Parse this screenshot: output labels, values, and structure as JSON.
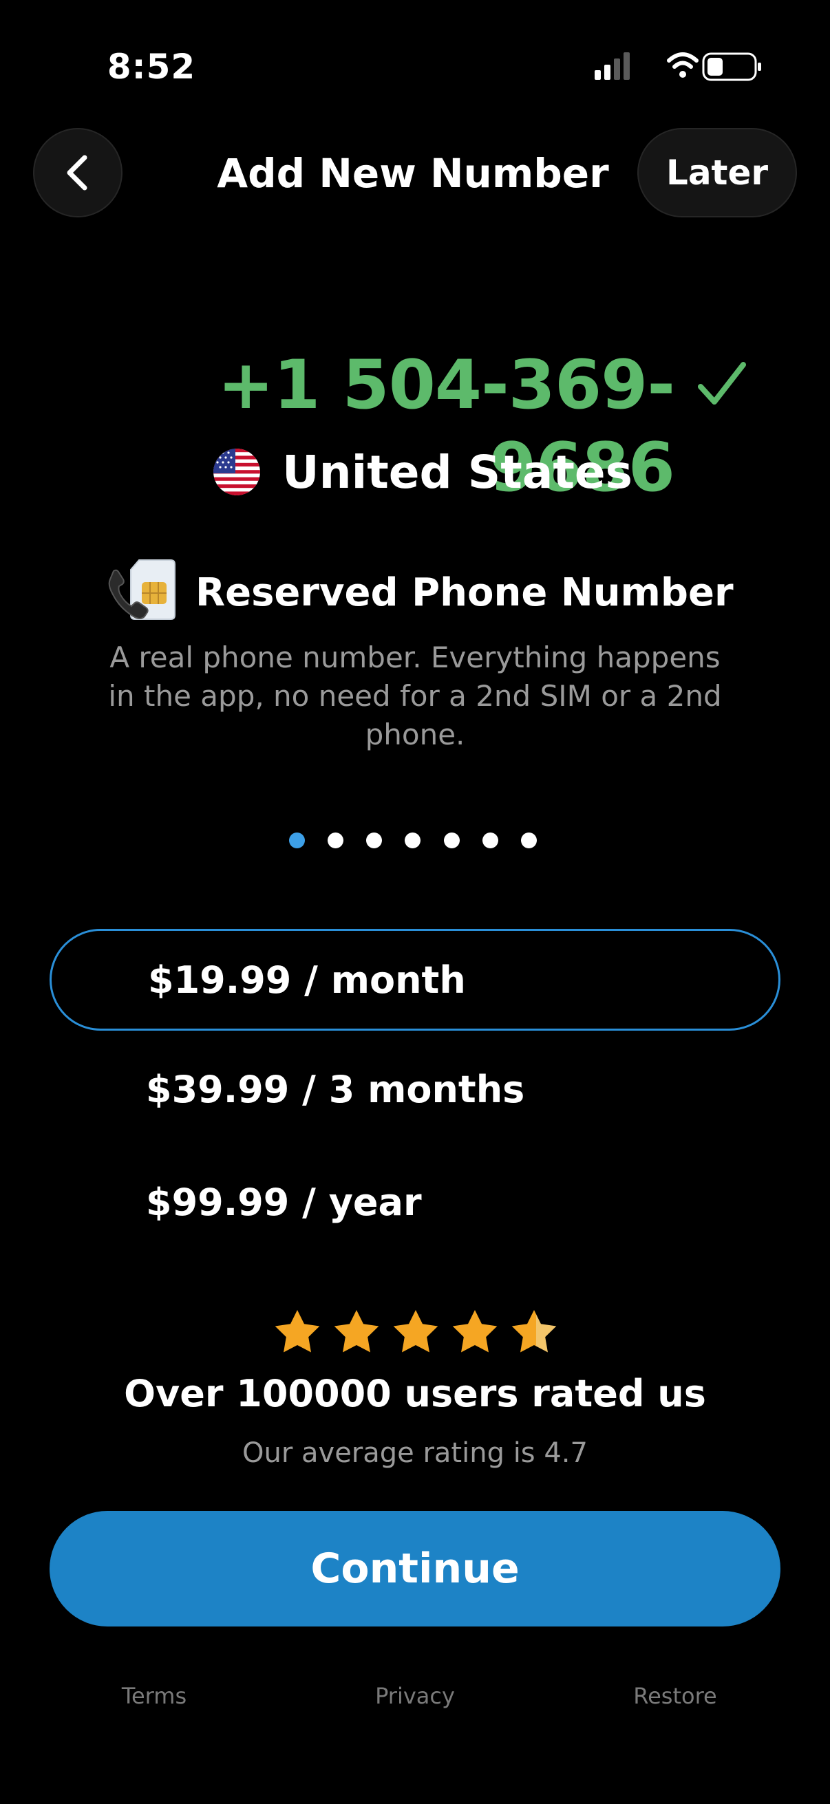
{
  "status_bar": {
    "time": "8:52",
    "icons": [
      "cellular-signal-icon",
      "wifi-icon",
      "battery-icon"
    ]
  },
  "header": {
    "back_icon": "chevron-left-icon",
    "title": "Add New Number",
    "later_label": "Later"
  },
  "number": {
    "phone": "+1 504-369-9686",
    "verified_icon": "check-icon",
    "accent_color": "#5dba6b",
    "country_flag_icon": "us-flag-icon",
    "country": "United States"
  },
  "feature": {
    "icon": "phone-sim-icon",
    "title": "Reserved Phone Number",
    "description": "A real phone number. Everything happens in the app, no need for a 2nd SIM or a 2nd phone."
  },
  "pagination": {
    "total": 7,
    "active_index": 0,
    "active_color": "#3da0e8"
  },
  "plans": [
    {
      "label": "$19.99 / month",
      "selected": true
    },
    {
      "label": "$39.99 / 3 months",
      "selected": false
    },
    {
      "label": "$99.99 / year",
      "selected": false
    }
  ],
  "rating": {
    "stars_shown": 5,
    "star_color": "#f5a623",
    "title": "Over 100000 users rated us",
    "subtitle": "Our average rating is 4.7"
  },
  "continue_label": "Continue",
  "continue_color": "#1d83c6",
  "footer": {
    "terms": "Terms",
    "privacy": "Privacy",
    "restore": "Restore"
  }
}
